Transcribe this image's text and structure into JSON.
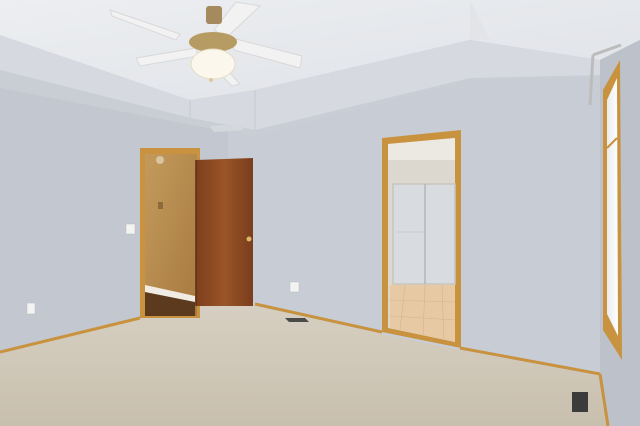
{
  "scene": {
    "subject": "empty-bedroom-interior",
    "colors": {
      "wall_left": "#c3c8d1",
      "wall_back": "#c7ccd5",
      "wall_right": "#bfc4cd",
      "ceiling": "#e6e8ec",
      "tray_face": "#d9dce2",
      "carpet": "#cfc6b6",
      "trim": "#c8923e",
      "door_wood": "#8a4a22",
      "hall_wall": "#b88a4c",
      "bath_tile": "#e7c9a4",
      "glass": "#d8dce0"
    },
    "objects": [
      "ceiling-fan",
      "tray-ceiling",
      "open-door-left",
      "doorway-bathroom",
      "shower-enclosure",
      "window-right",
      "curtain-rod",
      "floor-vent-left",
      "floor-vent-right",
      "light-switch",
      "wall-outlets",
      "carpet-floor"
    ]
  }
}
